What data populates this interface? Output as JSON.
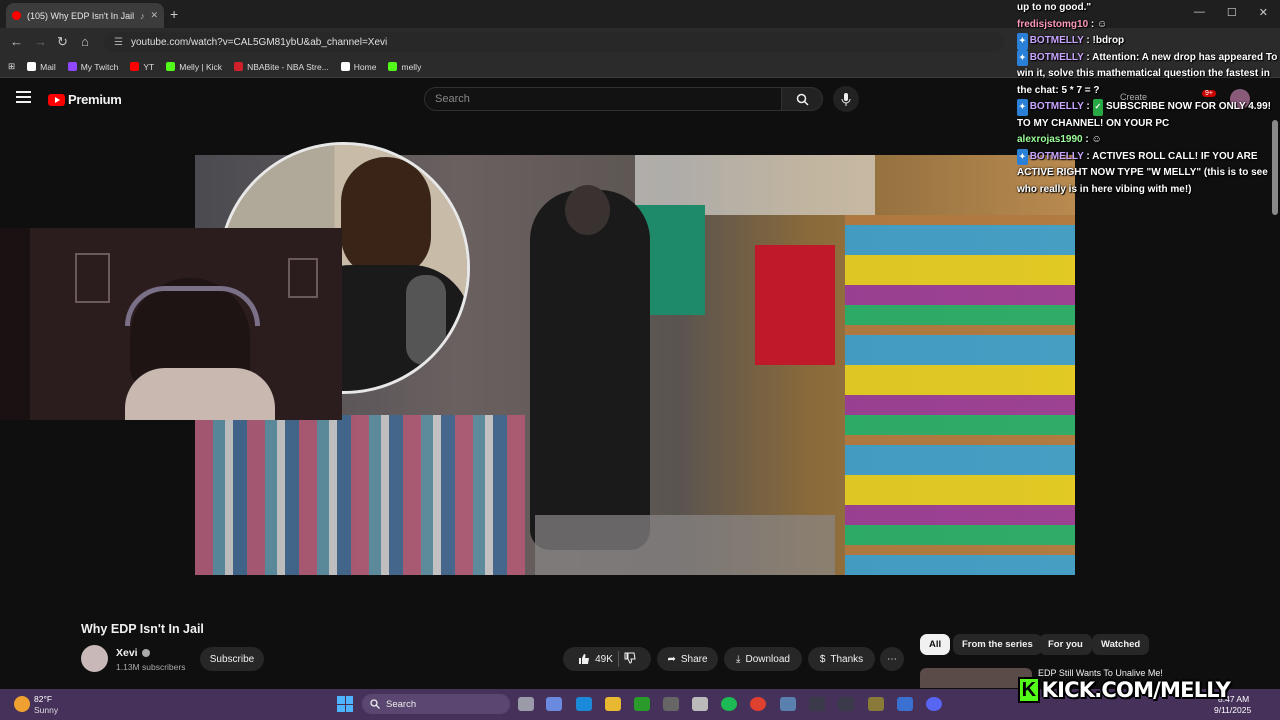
{
  "browser": {
    "tab_title": "(105) Why EDP Isn't In Jail",
    "tab_close": "✕",
    "new_tab": "+",
    "url": "youtube.com/watch?v=CAL5GM81ybU&ab_channel=Xevi",
    "bookmarks": [
      {
        "label": "Mail",
        "color": "#ffffff"
      },
      {
        "label": "My Twitch",
        "color": "#9146ff"
      },
      {
        "label": "YT",
        "color": "#ff0000"
      },
      {
        "label": "Melly | Kick",
        "color": "#53fc18"
      },
      {
        "label": "NBABite - NBA Stre...",
        "color": "#d0202a"
      },
      {
        "label": "Home",
        "color": "#ffffff"
      },
      {
        "label": "melly",
        "color": "#53fc18"
      }
    ],
    "window_controls": [
      "—",
      "☐",
      "✕"
    ]
  },
  "youtube": {
    "logo_text": "Premium",
    "search_placeholder": "Search",
    "create_label": "Create",
    "notification_count": "9+",
    "video": {
      "title": "Why EDP Isn't In Jail",
      "channel": "Xevi",
      "subscribers": "1.13M subscribers",
      "subscribe_label": "Subscribe",
      "likes": "49K",
      "share_label": "Share",
      "download_label": "Download",
      "thanks_label": "Thanks",
      "more_label": "⋯"
    },
    "chips": [
      {
        "label": "All",
        "active": true
      },
      {
        "label": "From the series",
        "active": false
      },
      {
        "label": "For you",
        "active": false
      },
      {
        "label": "Watched",
        "active": false
      }
    ],
    "recommendation_title": "EDP Still Wants To Unalive Me!"
  },
  "chat": {
    "messages": [
      {
        "user": "",
        "text": "up to no good.\""
      },
      {
        "user": "fredisjstomg10",
        "text": ""
      },
      {
        "user": "BOTMELLY",
        "text": "!bdrop"
      },
      {
        "user": "BOTMELLY",
        "text": "Attention: A new drop has appeared   To win it, solve this mathematical question the fastest in the chat: 5 * 7 = ?"
      },
      {
        "user": "BOTMELLY",
        "text": "SUBSCRIBE NOW FOR ONLY 4.99!  TO MY CHANNEL! ON YOUR PC"
      },
      {
        "user": "alexrojas1990",
        "text": ""
      },
      {
        "user": "BOTMELLY",
        "text": "ACTIVES ROLL CALL! IF YOU ARE ACTIVE RIGHT NOW TYPE \"W MELLY\" (this is to see who really is in here vibing with me!)"
      }
    ]
  },
  "taskbar": {
    "weather_temp": "82°F",
    "weather_desc": "Sunny",
    "search_label": "Search",
    "time": "8:47 AM",
    "date": "9/11/2025"
  },
  "overlay": {
    "kick_letter": "K",
    "kick_url": "KICK.COM/MELLY"
  }
}
